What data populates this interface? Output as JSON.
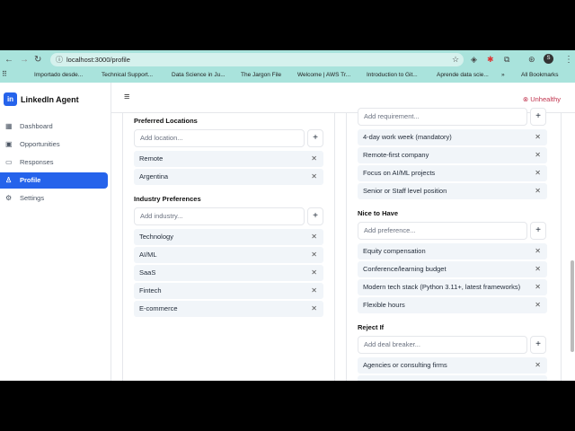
{
  "browser": {
    "url": "localhost:3000/profile",
    "bookmarks": [
      "Importado desde...",
      "Technical Support...",
      "Data Science in Ju...",
      "The Jargon File",
      "Welcome | AWS Tr...",
      "Introduction to Git...",
      "Aprende data scie...",
      "»",
      "All Bookmarks"
    ]
  },
  "app": {
    "brand": "LinkedIn Agent",
    "status": "Unhealthy"
  },
  "sidebar": {
    "items": [
      {
        "label": "Dashboard"
      },
      {
        "label": "Opportunities"
      },
      {
        "label": "Responses"
      },
      {
        "label": "Profile"
      },
      {
        "label": "Settings"
      }
    ]
  },
  "left": {
    "locations": {
      "title": "Preferred Locations",
      "placeholder": "Add location...",
      "items": [
        "Remote",
        "Argentina"
      ]
    },
    "industries": {
      "title": "Industry Preferences",
      "placeholder": "Add industry...",
      "items": [
        "Technology",
        "AI/ML",
        "SaaS",
        "Fintech",
        "E-commerce"
      ]
    }
  },
  "right": {
    "requirements": {
      "placeholder": "Add requirement...",
      "items": [
        "4-day work week (mandatory)",
        "Remote-first company",
        "Focus on AI/ML projects",
        "Senior or Staff level position"
      ]
    },
    "nice": {
      "title": "Nice to Have",
      "placeholder": "Add preference...",
      "items": [
        "Equity compensation",
        "Conference/learning budget",
        "Modern tech stack (Python 3.11+, latest frameworks)",
        "Flexible hours"
      ]
    },
    "reject": {
      "title": "Reject If",
      "placeholder": "Add deal breaker...",
      "items": [
        "Agencies or consulting firms"
      ]
    }
  }
}
